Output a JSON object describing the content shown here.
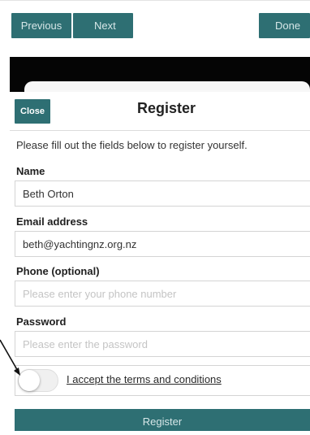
{
  "toolbar": {
    "previous_label": "Previous",
    "next_label": "Next",
    "done_label": "Done"
  },
  "modal": {
    "close_label": "Close",
    "title": "Register",
    "intro": "Please fill out the fields below to register yourself."
  },
  "form": {
    "name": {
      "label": "Name",
      "value": "Beth Orton",
      "placeholder": ""
    },
    "email": {
      "label": "Email address",
      "value": "beth@yachtingnz.org.nz",
      "placeholder": ""
    },
    "phone": {
      "label": "Phone (optional)",
      "value": "",
      "placeholder": "Please enter your phone number"
    },
    "password": {
      "label": "Password",
      "value": "",
      "placeholder": "Please enter the password"
    },
    "terms": {
      "label": "I accept the terms and conditions",
      "accepted": false
    },
    "register_label": "Register"
  },
  "colors": {
    "accent": "#2e6f73",
    "button_text": "#d7e7e8",
    "backdrop": "#050505"
  },
  "icons": {
    "annotation": "arrow-icon"
  }
}
